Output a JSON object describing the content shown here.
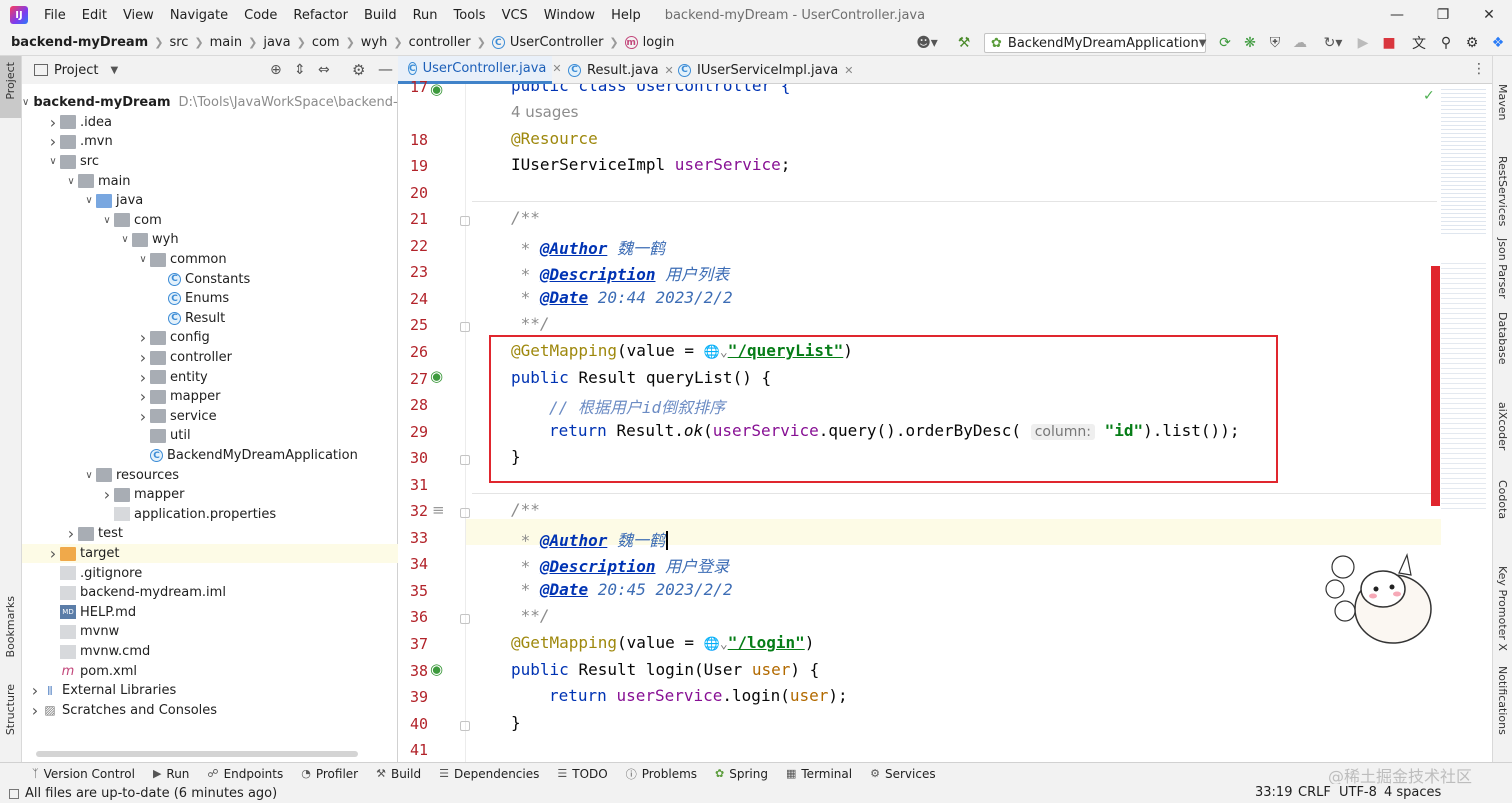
{
  "menu": {
    "items": [
      "File",
      "Edit",
      "View",
      "Navigate",
      "Code",
      "Refactor",
      "Build",
      "Run",
      "Tools",
      "VCS",
      "Window",
      "Help"
    ],
    "title": "backend-myDream - UserController.java"
  },
  "nav": {
    "project": "backend-myDream",
    "crumbs": [
      "src",
      "main",
      "java",
      "com",
      "wyh",
      "controller"
    ],
    "class_crumb": "UserController",
    "method_crumb": "login",
    "run_config": "BackendMyDreamApplication"
  },
  "left_tabs": {
    "project": "Project",
    "bookmarks": "Bookmarks",
    "structure": "Structure"
  },
  "project_panel": {
    "header": "Project",
    "root_name": "backend-myDream",
    "root_path": "D:\\Tools\\JavaWorkSpace\\backend-my",
    "tree": [
      {
        "label": "backend-myDream",
        "depth": 0,
        "arrow": "open",
        "icon": "folder"
      },
      {
        "label": ".idea",
        "depth": 1,
        "arrow": "closed",
        "icon": "folder"
      },
      {
        "label": ".mvn",
        "depth": 1,
        "arrow": "closed",
        "icon": "folder"
      },
      {
        "label": "src",
        "depth": 1,
        "arrow": "open",
        "icon": "folder"
      },
      {
        "label": "main",
        "depth": 2,
        "arrow": "open",
        "icon": "folder"
      },
      {
        "label": "java",
        "depth": 3,
        "arrow": "open",
        "icon": "folder-blue"
      },
      {
        "label": "com",
        "depth": 4,
        "arrow": "open",
        "icon": "package"
      },
      {
        "label": "wyh",
        "depth": 5,
        "arrow": "open",
        "icon": "package"
      },
      {
        "label": "common",
        "depth": 6,
        "arrow": "open",
        "icon": "package"
      },
      {
        "label": "Constants",
        "depth": 7,
        "arrow": "none",
        "icon": "class"
      },
      {
        "label": "Enums",
        "depth": 7,
        "arrow": "none",
        "icon": "class"
      },
      {
        "label": "Result",
        "depth": 7,
        "arrow": "none",
        "icon": "class"
      },
      {
        "label": "config",
        "depth": 6,
        "arrow": "closed",
        "icon": "package"
      },
      {
        "label": "controller",
        "depth": 6,
        "arrow": "closed",
        "icon": "package"
      },
      {
        "label": "entity",
        "depth": 6,
        "arrow": "closed",
        "icon": "package"
      },
      {
        "label": "mapper",
        "depth": 6,
        "arrow": "closed",
        "icon": "package"
      },
      {
        "label": "service",
        "depth": 6,
        "arrow": "closed",
        "icon": "package"
      },
      {
        "label": "util",
        "depth": 6,
        "arrow": "none",
        "icon": "package"
      },
      {
        "label": "BackendMyDreamApplication",
        "depth": 6,
        "arrow": "none",
        "icon": "springclass"
      },
      {
        "label": "resources",
        "depth": 3,
        "arrow": "open",
        "icon": "folder"
      },
      {
        "label": "mapper",
        "depth": 4,
        "arrow": "closed",
        "icon": "folder"
      },
      {
        "label": "application.properties",
        "depth": 4,
        "arrow": "none",
        "icon": "props"
      },
      {
        "label": "test",
        "depth": 2,
        "arrow": "closed",
        "icon": "folder"
      },
      {
        "label": "target",
        "depth": 1,
        "arrow": "closed",
        "icon": "folder-orange"
      },
      {
        "label": ".gitignore",
        "depth": 1,
        "arrow": "none",
        "icon": "file"
      },
      {
        "label": "backend-mydream.iml",
        "depth": 1,
        "arrow": "none",
        "icon": "file"
      },
      {
        "label": "HELP.md",
        "depth": 1,
        "arrow": "none",
        "icon": "md"
      },
      {
        "label": "mvnw",
        "depth": 1,
        "arrow": "none",
        "icon": "file"
      },
      {
        "label": "mvnw.cmd",
        "depth": 1,
        "arrow": "none",
        "icon": "file"
      },
      {
        "label": "pom.xml",
        "depth": 1,
        "arrow": "none",
        "icon": "maven"
      },
      {
        "label": "External Libraries",
        "depth": 0,
        "arrow": "closed",
        "icon": "lib"
      },
      {
        "label": "Scratches and Consoles",
        "depth": 0,
        "arrow": "closed",
        "icon": "scratch"
      }
    ]
  },
  "editor_tabs": [
    {
      "label": "UserController.java",
      "active": true
    },
    {
      "label": "Result.java",
      "active": false
    },
    {
      "label": "IUserServiceImpl.java",
      "active": false
    }
  ],
  "editor": {
    "line_numbers": [
      "17",
      "18",
      "19",
      "20",
      "21",
      "22",
      "23",
      "24",
      "25",
      "26",
      "27",
      "28",
      "29",
      "30",
      "31",
      "32",
      "33",
      "34",
      "35",
      "36",
      "37",
      "38",
      "39",
      "40",
      "41"
    ],
    "usages": "4 usages",
    "l17": "public class UserController {",
    "l18": "@Resource",
    "l19_type": "IUserServiceImpl ",
    "l19_field": "userService",
    "l19_end": ";",
    "doc_open": "/**",
    "doc_star": " * ",
    "doc_close": " **/",
    "author_tag": "@Author",
    "author_val": " 魏一鹤",
    "desc_tag": "@Description",
    "desc_val1": " 用户列表",
    "desc_val2": " 用户登录",
    "date_tag": "@Date",
    "date_val1": " 20:44 2023/2/2",
    "date_val2": " 20:45 2023/2/2",
    "l26_ann": "@GetMapping",
    "l26_a": "(value = ",
    "l26_str": "\"/queryList\"",
    "l26_end": ")",
    "l27_kw": "public ",
    "l27_rest": "Result queryList() {",
    "l28_cmt": "// 根据用户id倒叙排序",
    "l29_kw": "return ",
    "l29_a": "Result.",
    "l29_ok": "ok",
    "l29_b": "(",
    "l29_field": "userService",
    "l29_c": ".query().orderByDesc(",
    "l29_hint": "column:",
    "l29_str": "\"id\"",
    "l29_d": ").list());",
    "brace": "}",
    "l37_ann": "@GetMapping",
    "l37_a": "(value = ",
    "l37_str": "\"/login\"",
    "l37_end": ")",
    "l38_kw": "public ",
    "l38_a": "Result login(User ",
    "l38_param": "user",
    "l38_b": ") {",
    "l39_kw": "return ",
    "l39_field": "userService",
    "l39_a": ".login(",
    "l39_param": "user",
    "l39_b": ");"
  },
  "right_tabs": [
    "Maven",
    "RestServices",
    "Json Parser",
    "Database",
    "aiXcoder",
    "Codota",
    "Key Promoter X",
    "Notifications"
  ],
  "bottom_tools": [
    "Version Control",
    "Run",
    "Endpoints",
    "Profiler",
    "Build",
    "Dependencies",
    "TODO",
    "Problems",
    "Spring",
    "Terminal",
    "Services"
  ],
  "status": {
    "message": "All files are up-to-date (6 minutes ago)",
    "position": "33:19",
    "line_sep": "CRLF",
    "encoding": "UTF-8",
    "indent": "4 spaces",
    "watermark": "@稀土掘金技术社区"
  },
  "colors": {
    "accent": "#4083c9",
    "highlight_box": "#e0262e",
    "line_number": "#b2232a"
  }
}
